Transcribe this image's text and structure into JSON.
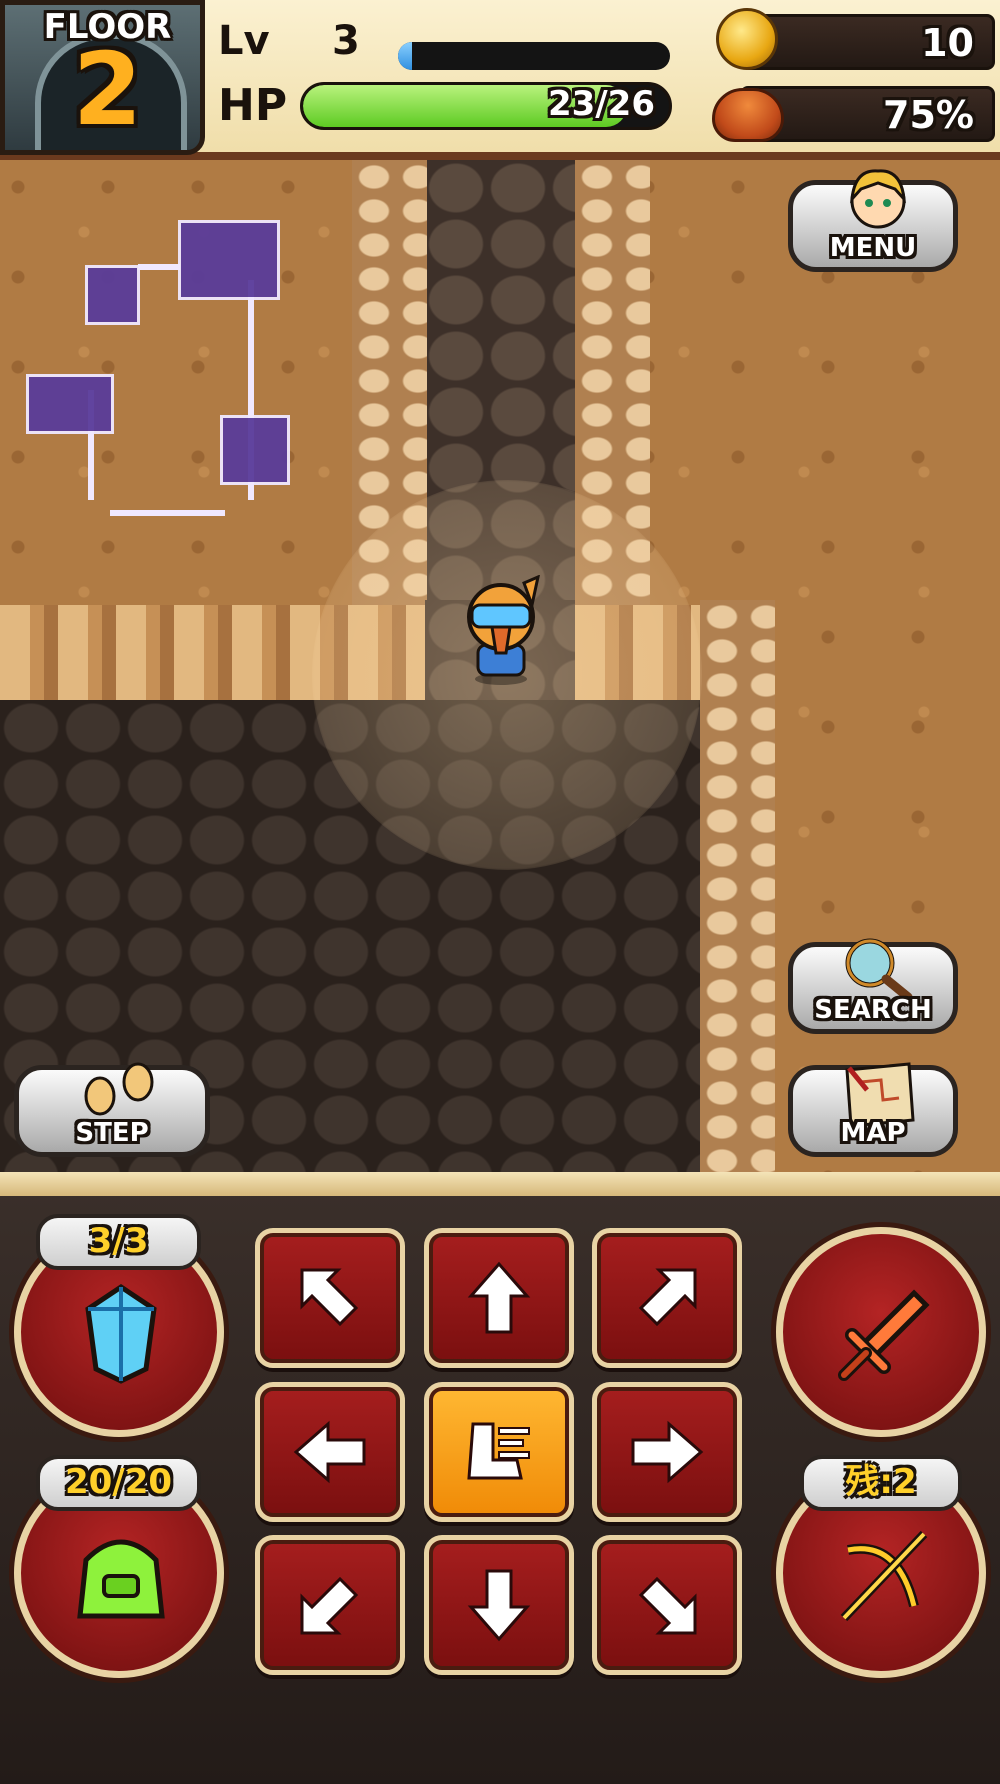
{
  "hud": {
    "floor_label": "FLOOR",
    "floor_number": "2",
    "level_label": "Lv",
    "level_value": "3",
    "exp_progress": 0.05,
    "hp_label": "HP",
    "hp_text": "23/26",
    "hp_current": 23,
    "hp_max": 26,
    "gold": "10",
    "satiety": "75%"
  },
  "buttons": {
    "menu": "MENU",
    "search": "SEARCH",
    "map": "MAP",
    "step": "STEP"
  },
  "controls": {
    "crystal_count": "3/3",
    "bag_count": "20/20",
    "arrows_left": "残:2"
  },
  "colors": {
    "hp_fill": "#5ecb23",
    "exp_fill": "#2f8fe0",
    "dpad_red": "#a61e1e",
    "wait_orange": "#f08a06",
    "minimap_room": "#5a3c9a"
  }
}
